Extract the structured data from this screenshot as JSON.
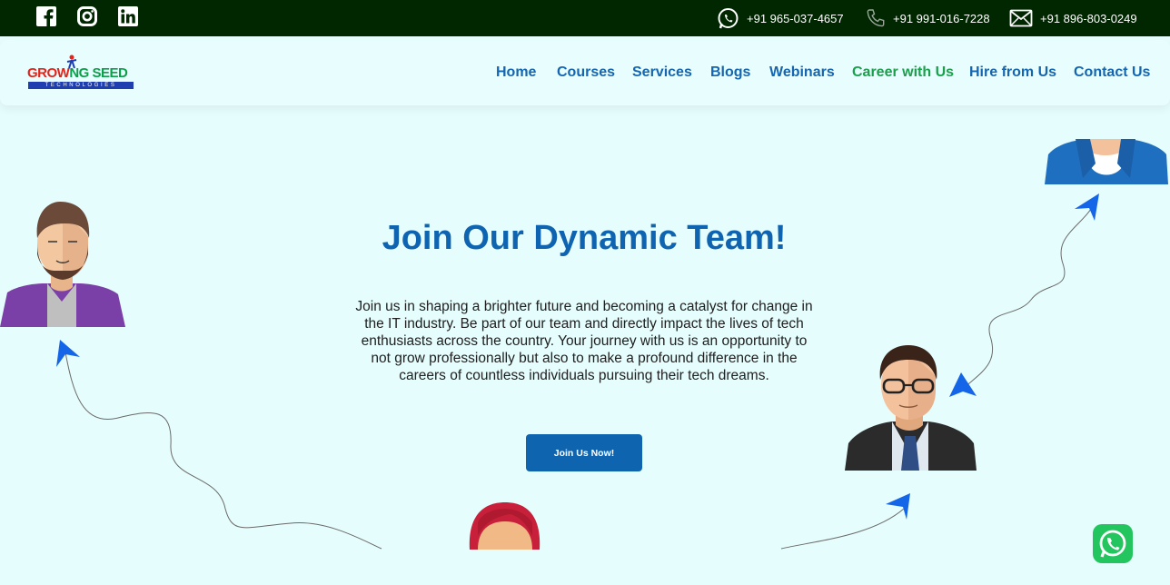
{
  "topbar": {
    "social": [
      "facebook-icon",
      "instagram-icon",
      "linkedin-icon"
    ],
    "contacts": [
      {
        "icon": "whatsapp-icon",
        "text": "+91 965-037-4657"
      },
      {
        "icon": "phone-icon",
        "text": "+91 991-016-7228"
      },
      {
        "icon": "mail-icon",
        "text": "+91 896-803-0249"
      }
    ]
  },
  "brand": {
    "name_part1": "GROW",
    "name_part2": "NG SEED",
    "tagline": "TECHNOLOGIES"
  },
  "nav": {
    "items": [
      "Home",
      "Courses",
      "Services",
      "Blogs",
      "Webinars",
      "Career with Us",
      "Hire from Us",
      "Contact Us"
    ],
    "active": "Career with Us"
  },
  "hero": {
    "title": "Join Our Dynamic Team!",
    "description": "Join us in shaping a brighter future and becoming a catalyst for change in the IT industry. Be part of our team and directly impact the lives of tech enthusiasts across the country. Your journey with us is an opportunity to not grow professionally but also to make a profound difference in the careers of countless individuals pursuing their tech dreams.",
    "cta_label": "Join Us Now!"
  },
  "colors": {
    "topbar_bg": "#002700",
    "page_bg": "#e6fdfd",
    "primary": "#0f64b0",
    "active_nav": "#1aa04c",
    "whatsapp": "#22c55e"
  }
}
